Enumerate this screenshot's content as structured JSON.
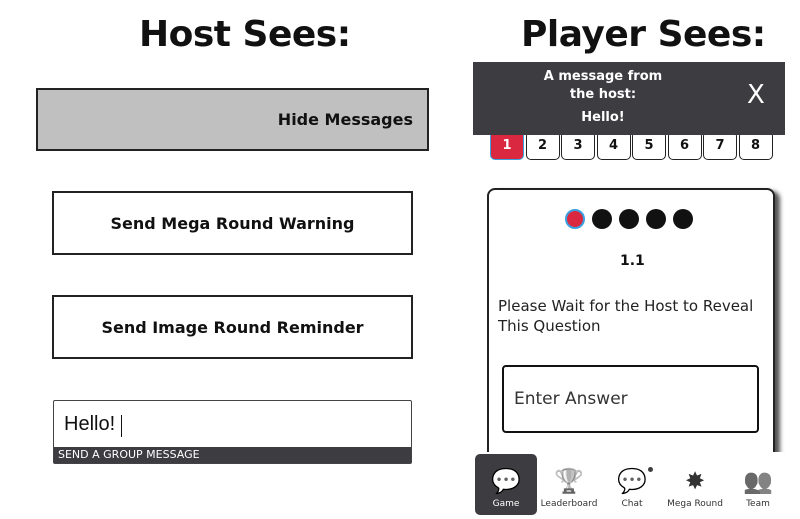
{
  "host": {
    "title": "Host Sees:",
    "hide_messages": "Hide Messages",
    "mega_warning": "Send Mega Round Warning",
    "image_reminder": "Send Image Round Reminder",
    "message_value": "Hello!",
    "message_label": "SEND A GROUP MESSAGE"
  },
  "player": {
    "title": "Player Sees:",
    "banner": {
      "heading": "A message from the host:",
      "message": "Hello!",
      "close": "X"
    },
    "questions": [
      "1",
      "2",
      "3",
      "4",
      "5",
      "6",
      "7",
      "8"
    ],
    "active_question": "1",
    "accent": "#d9283f",
    "question_number": "1.1",
    "prompt": "Please Wait for the Host to Reveal This Question",
    "answer_placeholder": "Enter Answer",
    "nav": [
      {
        "label": "Game",
        "icon": "game-icon"
      },
      {
        "label": "Leaderboard",
        "icon": "trophy-icon"
      },
      {
        "label": "Chat",
        "icon": "chat-icon"
      },
      {
        "label": "Mega Round",
        "icon": "mega-round-icon"
      },
      {
        "label": "Team",
        "icon": "team-icon"
      }
    ]
  }
}
